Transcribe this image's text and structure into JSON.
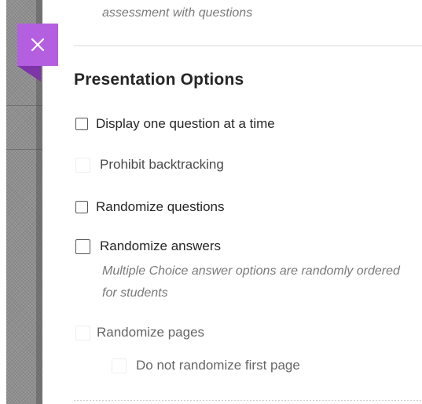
{
  "header": {
    "description_tail": "assessment with questions"
  },
  "close_button": {
    "glyph": "✕",
    "color": "#b45fe0"
  },
  "section": {
    "title": "Presentation Options"
  },
  "options": {
    "display_one": {
      "label": "Display one question at a time",
      "checked": false
    },
    "prohibit_backtracking": {
      "label": "Prohibit backtracking",
      "checked": false,
      "enabled": false
    },
    "randomize_questions": {
      "label": "Randomize questions",
      "checked": false
    },
    "randomize_answers": {
      "label": "Randomize answers",
      "checked": false,
      "description": "Multiple Choice answer options are randomly ordered for students"
    },
    "randomize_pages": {
      "label": "Randomize pages",
      "checked": false,
      "enabled": false
    },
    "no_randomize_first": {
      "label": "Do not randomize first page",
      "checked": false,
      "enabled": false
    }
  }
}
